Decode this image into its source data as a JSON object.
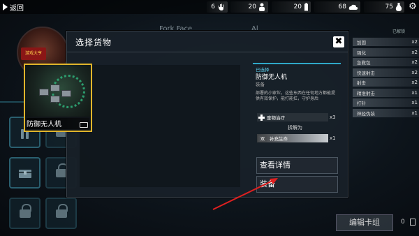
{
  "topbar": {
    "back_label": "返回",
    "resources": [
      {
        "value": "6",
        "icon": "hand-icon"
      },
      {
        "value": "20",
        "icon": "person-icon"
      },
      {
        "value": "20",
        "icon": "battery-icon"
      },
      {
        "value": "68",
        "icon": "cloud-icon"
      },
      {
        "value": "75",
        "icon": "potion-icon"
      }
    ]
  },
  "background": {
    "portrait_badge": "游戏大亨",
    "faded_title": "Fork Face",
    "faded_suffix": "Al",
    "list_header": "已解锁",
    "list_items": [
      {
        "name": "加固",
        "count": "x2"
      },
      {
        "name": "强化",
        "count": "x2"
      },
      {
        "name": "急救包",
        "count": "x2"
      },
      {
        "name": "快速射击",
        "count": "x2"
      },
      {
        "name": "射击",
        "count": "x2"
      },
      {
        "name": "精准射击",
        "count": "x1"
      },
      {
        "name": "打针",
        "count": "x1"
      },
      {
        "name": "神经伪装",
        "count": "x1"
      }
    ],
    "edit_deck_label": "编辑卡组",
    "edit_deck_count": "0"
  },
  "dialog": {
    "title": "选择货物",
    "card": {
      "name": "防御无人机"
    },
    "detail": {
      "selected_label": "已选择",
      "item_name": "防御无人机",
      "item_type": "装备",
      "description": "部署的小家伙，这些东西在任何地方都能提供有效保护，能打能扛，守护身后",
      "reward_name": "废物治疗",
      "reward_count": "x3",
      "split_label": "拆解为",
      "split_key": "双",
      "split_name": "补充生命",
      "split_count": "x1"
    },
    "view_details_label": "查看详情",
    "equip_label": "装备"
  },
  "colors": {
    "accent": "#2fa8c8",
    "card_border": "#e1b52b",
    "arrow": "#e02020"
  }
}
